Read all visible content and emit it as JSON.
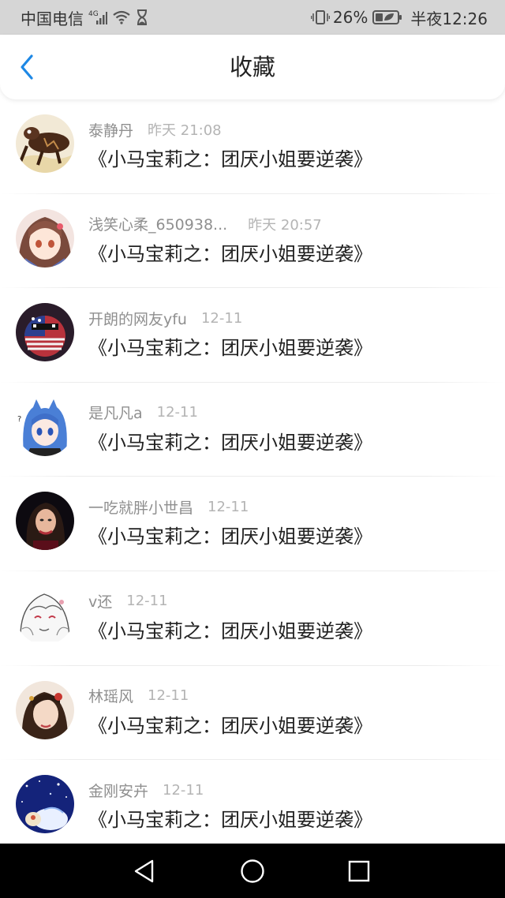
{
  "status_bar": {
    "carrier": "中国电信",
    "network": "4G",
    "battery": "26%",
    "time": "半夜12:26",
    "icons": [
      "signal-icon",
      "wifi-icon",
      "hourglass-icon",
      "vibrate-icon",
      "battery-icon"
    ]
  },
  "header": {
    "title": "收藏",
    "back_icon": "chevron-left-icon",
    "accent": "#1e88e5"
  },
  "favorites": [
    {
      "user": "泰静丹",
      "time": "昨天 21:08",
      "title": "《小马宝莉之：团厌小姐要逆袭》",
      "avatar": "avatar-1"
    },
    {
      "user": "浅笑心柔_650938...",
      "time": "昨天 20:57",
      "title": "《小马宝莉之：团厌小姐要逆袭》",
      "avatar": "avatar-2"
    },
    {
      "user": "开朗的网友yfu",
      "time": "12-11",
      "title": "《小马宝莉之：团厌小姐要逆袭》",
      "avatar": "avatar-3"
    },
    {
      "user": "是凡凡a",
      "time": "12-11",
      "title": "《小马宝莉之：团厌小姐要逆袭》",
      "avatar": "avatar-4"
    },
    {
      "user": "一吃就胖小世昌",
      "time": "12-11",
      "title": "《小马宝莉之：团厌小姐要逆袭》",
      "avatar": "avatar-5"
    },
    {
      "user": "v还",
      "time": "12-11",
      "title": "《小马宝莉之：团厌小姐要逆袭》",
      "avatar": "avatar-6"
    },
    {
      "user": "林瑶风",
      "time": "12-11",
      "title": "《小马宝莉之：团厌小姐要逆袭》",
      "avatar": "avatar-7"
    },
    {
      "user": "金刚安卉",
      "time": "12-11",
      "title": "《小马宝莉之：团厌小姐要逆袭》",
      "avatar": "avatar-8"
    }
  ],
  "nav_bar": {
    "icons": [
      "back-triangle-icon",
      "home-circle-icon",
      "recents-square-icon"
    ]
  }
}
